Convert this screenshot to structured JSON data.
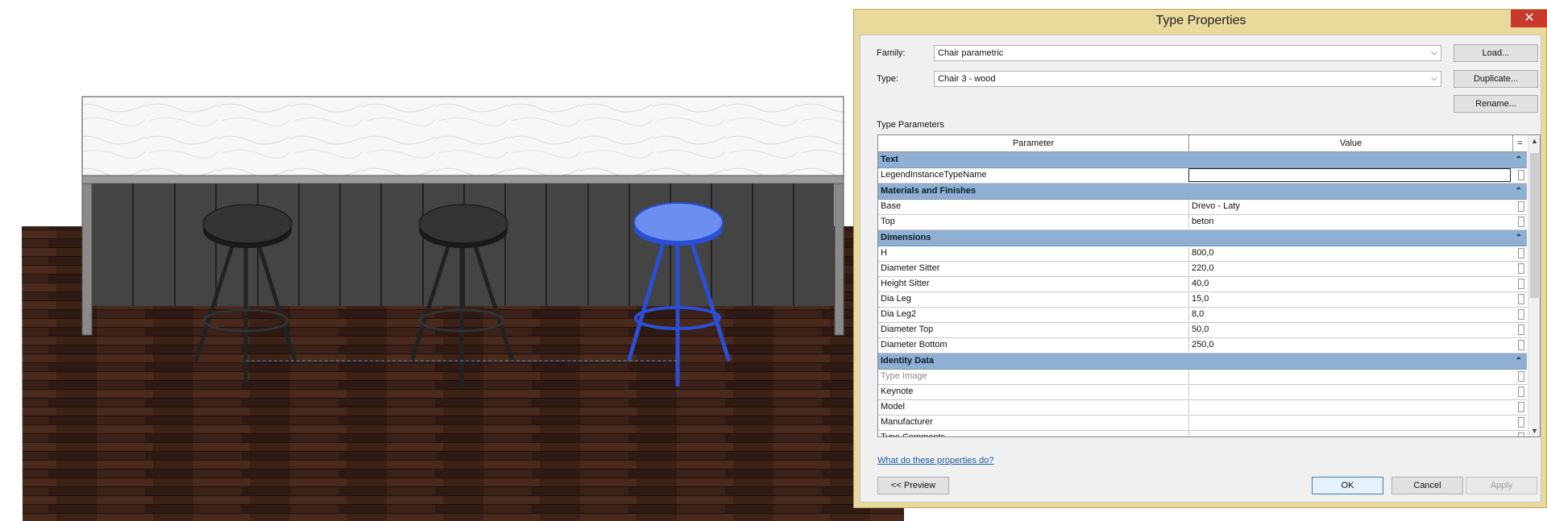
{
  "dialog": {
    "title": "Type Properties",
    "close_glyph": "✕",
    "family_label": "Family:",
    "family_value": "Chair parametric",
    "type_label": "Type:",
    "type_value": "Chair 3 - wood",
    "load_label": "Load...",
    "duplicate_label": "Duplicate...",
    "rename_label": "Rename...",
    "section_label": "Type Parameters",
    "col_parameter": "Parameter",
    "col_value": "Value",
    "col_sort": "=",
    "collapse_glyph": "⌃",
    "groups": [
      {
        "name": "Text",
        "rows": [
          {
            "param": "LegendInstanceTypeName",
            "value": "",
            "editing": true
          }
        ]
      },
      {
        "name": "Materials and Finishes",
        "rows": [
          {
            "param": "Base",
            "value": "Drevo - Laty"
          },
          {
            "param": "Top",
            "value": "beton"
          }
        ]
      },
      {
        "name": "Dimensions",
        "rows": [
          {
            "param": "H",
            "value": "800,0"
          },
          {
            "param": "Diameter Sitter",
            "value": "220,0"
          },
          {
            "param": "Height Sitter",
            "value": "40,0"
          },
          {
            "param": "Dia Leg",
            "value": "15,0"
          },
          {
            "param": "Dia Leg2",
            "value": "8,0"
          },
          {
            "param": "Diameter Top",
            "value": "50,0"
          },
          {
            "param": "Diameter Bottom",
            "value": "250,0"
          }
        ]
      },
      {
        "name": "Identity Data",
        "rows": [
          {
            "param": "Type Image",
            "value": "",
            "dim": true
          },
          {
            "param": "Keynote",
            "value": ""
          },
          {
            "param": "Model",
            "value": ""
          },
          {
            "param": "Manufacturer",
            "value": ""
          },
          {
            "param": "Type Comments",
            "value": ""
          }
        ]
      }
    ],
    "help_link": "What do these properties do?",
    "preview_label": "<< Preview",
    "ok_label": "OK",
    "cancel_label": "Cancel",
    "apply_label": "Apply"
  },
  "colors": {
    "dialog_frame": "#e9d99b",
    "group_header": "#8fb0d2",
    "selection_blue": "#2a4fd6",
    "floor": "#3a2016"
  }
}
